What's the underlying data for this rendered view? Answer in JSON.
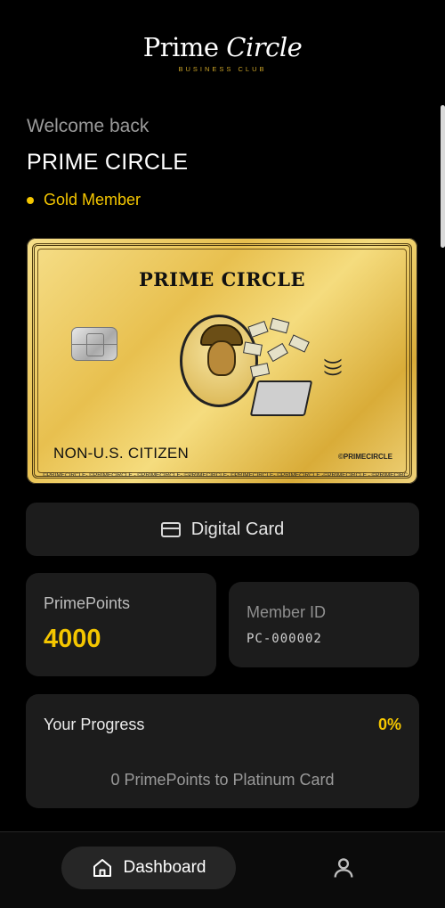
{
  "brand": {
    "name_regular": "Prime",
    "name_italic": "Circle",
    "tagline": "BUSINESS CLUB"
  },
  "greeting": {
    "welcome": "Welcome back",
    "username": "PRIME CIRCLE",
    "tier": "Gold Member",
    "tier_color": "#f4c600"
  },
  "card": {
    "title": "PRIME CIRCLE",
    "holder_text": "NON-U.S. CITIZEN",
    "handle": "©PRIMECIRCLE",
    "strip": "©PRIMECIRCLE- ©PRIMECIRCLE - ©PRIMECIRCLE- ©PRIMECIRCLE- ©PRIMECIRCLE- ©PRIMECIRCLE -©PRIMECIRCLE - ©PRIMECIRCLE",
    "contactless_icon": "contactless-icon"
  },
  "digital_card": {
    "label": "Digital Card",
    "icon": "credit-card-icon"
  },
  "points": {
    "label": "PrimePoints",
    "value": "4000"
  },
  "member": {
    "label": "Member ID",
    "value": "PC-000002"
  },
  "progress": {
    "label": "Your Progress",
    "percent": "0%",
    "note": "0 PrimePoints to Platinum Card"
  },
  "nav": {
    "dashboard_label": "Dashboard",
    "home_icon": "home-icon",
    "profile_icon": "user-icon"
  },
  "colors": {
    "accent": "#f4c600",
    "panel": "#1c1c1c",
    "background": "#000000"
  }
}
